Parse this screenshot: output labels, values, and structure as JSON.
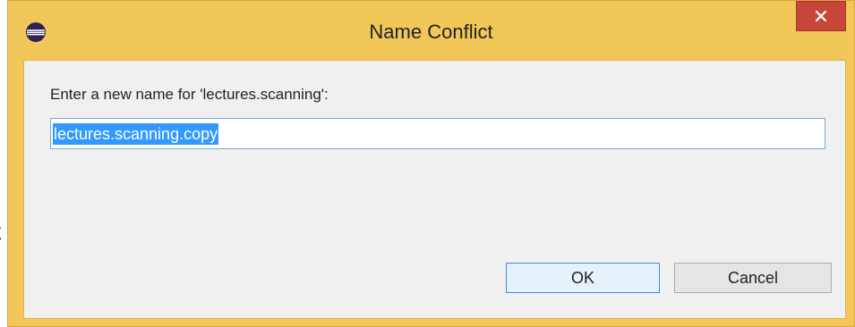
{
  "background": {
    "partial_text": "t"
  },
  "dialog": {
    "title": "Name Conflict",
    "app_icon": "eclipse-icon",
    "close_icon": "close-icon",
    "prompt_label": "Enter a new name for 'lectures.scanning':",
    "name_value": "lectures.scanning.copy",
    "ok_label": "OK",
    "cancel_label": "Cancel"
  },
  "colors": {
    "title_bar": "#f1c75a",
    "close_button": "#c7463a",
    "client_area": "#f0f0f0",
    "selection": "#3399ff",
    "default_button_border": "#3c8ee0"
  }
}
